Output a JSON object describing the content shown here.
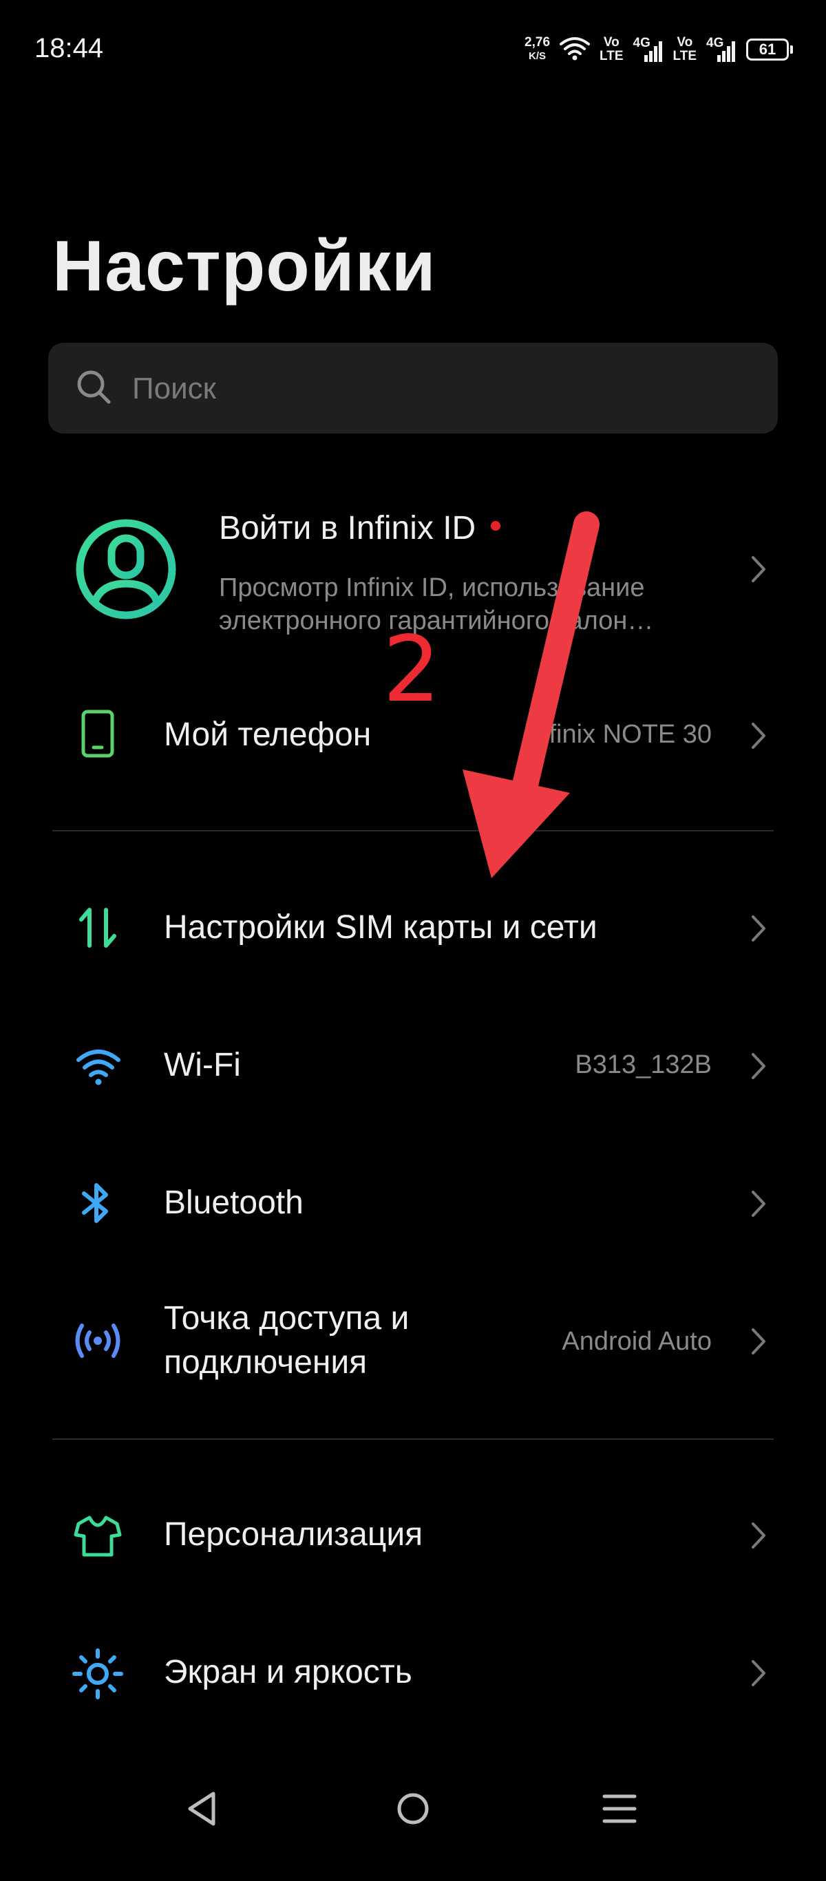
{
  "status_bar": {
    "time": "18:44",
    "net_speed_value": "2,76",
    "net_speed_unit": "K/S",
    "sim1_top": "Vo",
    "sim1_bottom": "LTE",
    "sim1_gen": "4G",
    "sim2_top": "Vo",
    "sim2_bottom": "LTE",
    "sim2_gen": "4G",
    "battery": "61"
  },
  "page": {
    "title": "Настройки"
  },
  "search": {
    "placeholder": "Поиск",
    "icon": "search-icon"
  },
  "account": {
    "title": "Войти в Infinix ID",
    "subtitle_line1": "Просмотр Infinix ID, использование",
    "subtitle_line2": "электронного гарантийного талон…",
    "accent": "#3ddc97"
  },
  "items": [
    {
      "label": "Мой телефон",
      "value": "Infinix NOTE 30",
      "icon": "phone-icon",
      "color": "#5bd16b"
    },
    {
      "label": "Настройки SIM карты и сети",
      "value": "",
      "icon": "sim-network-icon",
      "color": "#3ddc97"
    },
    {
      "label": "Wi-Fi",
      "value": "B313_132B",
      "icon": "wifi-icon",
      "color": "#3fa9f5"
    },
    {
      "label": "Bluetooth",
      "value": "",
      "icon": "bluetooth-icon",
      "color": "#3fa9f5"
    },
    {
      "label": "Точка доступа и подключения",
      "value": "Android Auto",
      "icon": "hotspot-icon",
      "color": "#5b8cf5"
    },
    {
      "label": "Персонализация",
      "value": "",
      "icon": "shirt-icon",
      "color": "#3ddc97"
    },
    {
      "label": "Экран и яркость",
      "value": "",
      "icon": "brightness-icon",
      "color": "#3fa9f5"
    }
  ],
  "annotation": {
    "number": "2",
    "color": "#ee2a32"
  },
  "navbar": {
    "back": "back-icon",
    "home": "home-icon",
    "recents": "recents-icon"
  }
}
